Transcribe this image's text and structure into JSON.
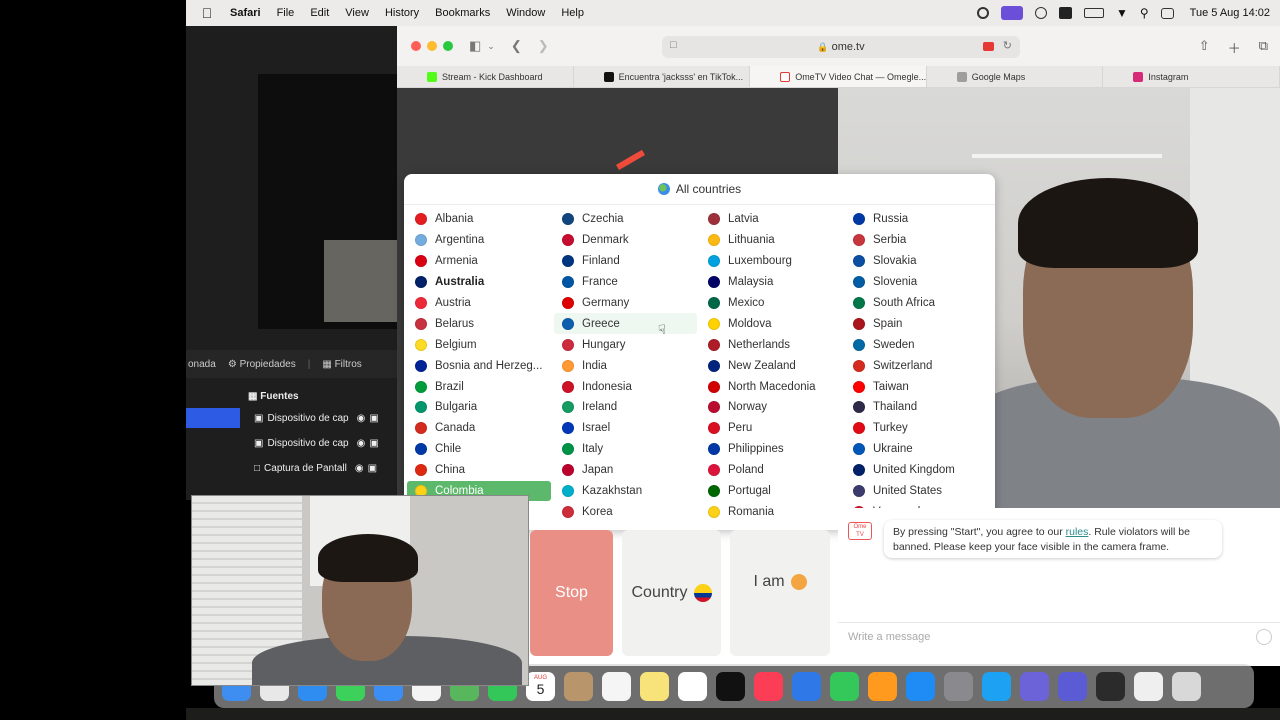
{
  "menubar": {
    "app": "Safari",
    "items": [
      "File",
      "Edit",
      "View",
      "History",
      "Bookmarks",
      "Window",
      "Help"
    ],
    "clock": "Tue 5 Aug  14:02"
  },
  "obs": {
    "prop_label": "Propiedades",
    "filters_label": "Filtros",
    "left_label": "onada",
    "sources_title": "Fuentes",
    "sources": [
      "Dispositivo de cap",
      "Dispositivo de cap",
      "Captura de Pantall"
    ]
  },
  "browser": {
    "url": "ome.tv",
    "tabs": [
      {
        "label": "Stream - Kick Dashboard",
        "color": "#53fc18"
      },
      {
        "label": "Encuentra 'jacksss' en TikTok...",
        "color": "#111111"
      },
      {
        "label": "OmeTV Video Chat — Omegle...",
        "color": "#e53935"
      },
      {
        "label": "Google Maps",
        "color": "#9e9e9e"
      },
      {
        "label": "Instagram",
        "color": "#d62976"
      }
    ]
  },
  "dropdown": {
    "title": "All countries",
    "columns": [
      [
        {
          "name": "Albania",
          "flag": "#e41e20"
        },
        {
          "name": "Argentina",
          "flag": "#74acdf"
        },
        {
          "name": "Armenia",
          "flag": "#d90012"
        },
        {
          "name": "Australia",
          "flag": "#012169",
          "bold": true
        },
        {
          "name": "Austria",
          "flag": "#ed2939"
        },
        {
          "name": "Belarus",
          "flag": "#c8313e"
        },
        {
          "name": "Belgium",
          "flag": "#fdda24"
        },
        {
          "name": "Bosnia and Herzeg...",
          "flag": "#002395"
        },
        {
          "name": "Brazil",
          "flag": "#009c3b"
        },
        {
          "name": "Bulgaria",
          "flag": "#00966e"
        },
        {
          "name": "Canada",
          "flag": "#d52b1e"
        },
        {
          "name": "Chile",
          "flag": "#0039a6"
        },
        {
          "name": "China",
          "flag": "#de2910"
        },
        {
          "name": "Colombia",
          "flag": "#fcd116",
          "selected": true
        }
      ],
      [
        {
          "name": "Czechia",
          "flag": "#11457e"
        },
        {
          "name": "Denmark",
          "flag": "#c60c30"
        },
        {
          "name": "Finland",
          "flag": "#003580"
        },
        {
          "name": "France",
          "flag": "#0055a4"
        },
        {
          "name": "Germany",
          "flag": "#dd0000"
        },
        {
          "name": "Greece",
          "flag": "#0d5eaf",
          "hover": true
        },
        {
          "name": "Hungary",
          "flag": "#cd2a3e"
        },
        {
          "name": "India",
          "flag": "#ff9933"
        },
        {
          "name": "Indonesia",
          "flag": "#ce1126"
        },
        {
          "name": "Ireland",
          "flag": "#169b62"
        },
        {
          "name": "Israel",
          "flag": "#0038b8"
        },
        {
          "name": "Italy",
          "flag": "#009246"
        },
        {
          "name": "Japan",
          "flag": "#bc002d"
        },
        {
          "name": "Kazakhstan",
          "flag": "#00afca"
        },
        {
          "name": "Korea",
          "flag": "#cd2e3a"
        }
      ],
      [
        {
          "name": "Latvia",
          "flag": "#9e3039"
        },
        {
          "name": "Lithuania",
          "flag": "#fdb913"
        },
        {
          "name": "Luxembourg",
          "flag": "#00a1de"
        },
        {
          "name": "Malaysia",
          "flag": "#010066"
        },
        {
          "name": "Mexico",
          "flag": "#006847"
        },
        {
          "name": "Moldova",
          "flag": "#ffd200"
        },
        {
          "name": "Netherlands",
          "flag": "#ae1c28"
        },
        {
          "name": "New Zealand",
          "flag": "#00247d"
        },
        {
          "name": "North Macedonia",
          "flag": "#d20000"
        },
        {
          "name": "Norway",
          "flag": "#ba0c2f"
        },
        {
          "name": "Peru",
          "flag": "#d91023"
        },
        {
          "name": "Philippines",
          "flag": "#0038a8"
        },
        {
          "name": "Poland",
          "flag": "#dc143c"
        },
        {
          "name": "Portugal",
          "flag": "#006600"
        },
        {
          "name": "Romania",
          "flag": "#fcd116"
        }
      ],
      [
        {
          "name": "Russia",
          "flag": "#0039a6"
        },
        {
          "name": "Serbia",
          "flag": "#c6363c"
        },
        {
          "name": "Slovakia",
          "flag": "#0b4ea2"
        },
        {
          "name": "Slovenia",
          "flag": "#005da4"
        },
        {
          "name": "South Africa",
          "flag": "#007749"
        },
        {
          "name": "Spain",
          "flag": "#aa151b"
        },
        {
          "name": "Sweden",
          "flag": "#006aa7"
        },
        {
          "name": "Switzerland",
          "flag": "#d52b1e"
        },
        {
          "name": "Taiwan",
          "flag": "#fe0000"
        },
        {
          "name": "Thailand",
          "flag": "#2d2a4a"
        },
        {
          "name": "Turkey",
          "flag": "#e30a17"
        },
        {
          "name": "Ukraine",
          "flag": "#0057b7"
        },
        {
          "name": "United Kingdom",
          "flag": "#012169"
        },
        {
          "name": "United States",
          "flag": "#3c3b6e"
        },
        {
          "name": "Venezuela",
          "flag": "#cf142b"
        }
      ]
    ]
  },
  "controls": {
    "stop": "Stop",
    "country": "Country",
    "iam": "I am"
  },
  "chat": {
    "bot_label": "Ome TV",
    "message_part1": "By pressing \"Start\", you agree to our ",
    "rules_link": "rules",
    "message_part2": ". Rule violators will be banned. Please keep your face visible in the camera frame.",
    "placeholder": "Write a message"
  },
  "dock": {
    "calendar_month": "AUG",
    "calendar_day": "5",
    "icons": [
      "finder-icon",
      "launchpad-icon",
      "safari-icon",
      "messages-icon",
      "mail-icon",
      "photos-icon",
      "maps-icon",
      "facetime-icon",
      "calendar-icon",
      "contacts-icon",
      "reminders-icon",
      "notes-icon",
      "freeform-icon",
      "tv-icon",
      "music-icon",
      "keynote-icon",
      "numbers-icon",
      "pages-icon",
      "app-store-icon",
      "system-settings-icon",
      "twitter-icon",
      "teams-icon",
      "shortcuts-icon",
      "obs-icon",
      "files-icon",
      "trash-icon"
    ]
  },
  "colors": {
    "stop_button": "#e98f86",
    "selected_country": "#5cb86a",
    "accent_link": "#2d8b8b"
  }
}
